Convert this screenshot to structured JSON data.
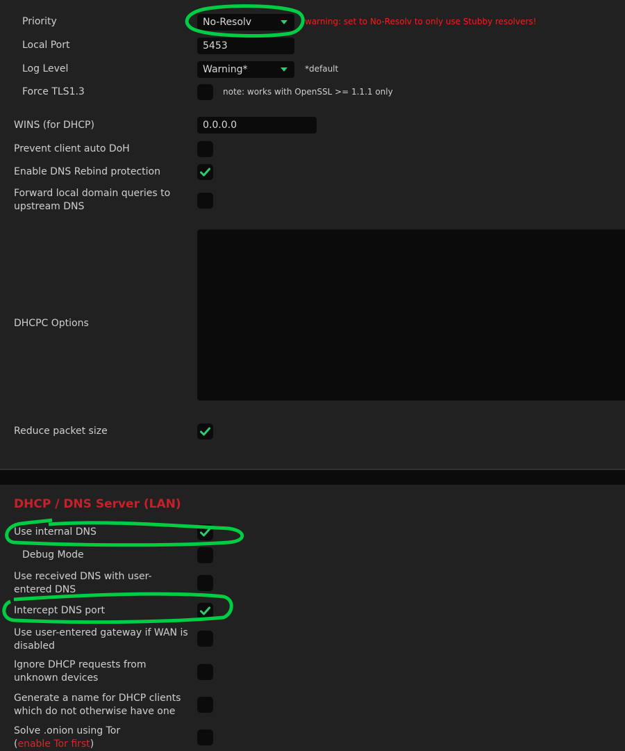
{
  "stubby": {
    "priority": {
      "label": "Priority",
      "value": "No-Resolv",
      "warning": "warning: set to No-Resolv to only use Stubby resolvers!"
    },
    "local_port": {
      "label": "Local Port",
      "value": "5453"
    },
    "log_level": {
      "label": "Log Level",
      "value": "Warning*",
      "note": "*default"
    },
    "force_tls": {
      "label": "Force TLS1.3",
      "checked": false,
      "note": "note: works with OpenSSL >= 1.1.1 only"
    }
  },
  "dns": {
    "wins": {
      "label": "WINS (for DHCP)",
      "value": "0.0.0.0"
    },
    "prevent_doh": {
      "label": "Prevent client auto DoH",
      "checked": false
    },
    "rebind": {
      "label": "Enable DNS Rebind protection",
      "checked": true
    },
    "forward_local": {
      "label": "Forward local domain queries to upstream DNS",
      "checked": false
    },
    "dhcpc_options": {
      "label": "DHCPC Options",
      "value": ""
    },
    "reduce_packet": {
      "label": "Reduce packet size",
      "checked": true
    }
  },
  "lan": {
    "title": "DHCP / DNS Server (LAN)",
    "use_internal_dns": {
      "label": "Use internal DNS",
      "checked": true
    },
    "debug_mode": {
      "label": "Debug Mode",
      "checked": false
    },
    "use_received_dns": {
      "label": "Use received DNS with user-entered DNS",
      "checked": false
    },
    "intercept_dns": {
      "label": "Intercept DNS port",
      "checked": true
    },
    "user_gateway": {
      "label": "Use user-entered gateway if WAN is disabled",
      "checked": false
    },
    "ignore_unknown": {
      "label": "Ignore DHCP requests from unknown devices",
      "checked": false
    },
    "generate_name": {
      "label": "Generate a name for DHCP clients which do not otherwise have one",
      "checked": false
    },
    "solve_onion": {
      "label_prefix": "Solve .onion using Tor",
      "paren_open": "(",
      "link": "enable Tor first",
      "paren_close": ")",
      "checked": false
    }
  },
  "colors": {
    "accent": "#2ecc71",
    "warning": "#ff1a1a",
    "section_title": "#c8202a",
    "annotation": "#00cc44"
  }
}
